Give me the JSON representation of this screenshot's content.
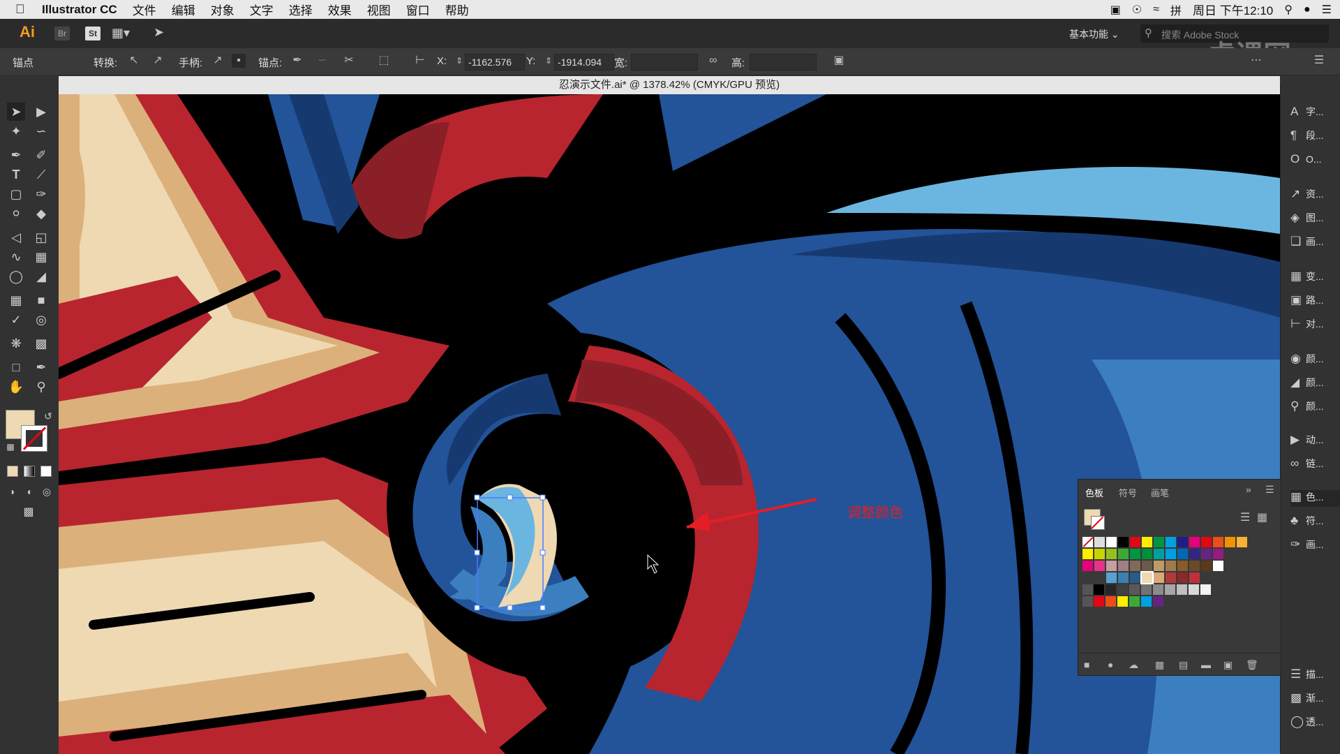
{
  "menubar": {
    "app_name": "Illustrator CC",
    "menus": [
      "文件",
      "编辑",
      "对象",
      "文字",
      "选择",
      "效果",
      "视图",
      "窗口",
      "帮助"
    ],
    "datetime": "周日 下午12:10"
  },
  "appbar": {
    "logo": "Ai",
    "bridge": "Br",
    "stock": "St",
    "workspace": "基本功能",
    "search_placeholder": "搜索 Adobe Stock",
    "watermark": "虎课网"
  },
  "control_bar": {
    "label_anchor": "锚点",
    "label_convert": "转换:",
    "label_handles": "手柄:",
    "label_anchors": "锚点:",
    "label_x": "X:",
    "x_value": "-1162.576",
    "label_y": "Y:",
    "y_value": "-1914.094",
    "label_width": "宽:",
    "label_height": "高:"
  },
  "document": {
    "title": "忍演示文件.ai* @ 1378.42% (CMYK/GPU 预览)"
  },
  "annotation": "调整颜色",
  "dock": {
    "items": [
      "字...",
      "段...",
      "O...",
      "资...",
      "图...",
      "画...",
      "变...",
      "路...",
      "对...",
      "颜...",
      "颜...",
      "颜...",
      "动...",
      "链...",
      "色...",
      "符...",
      "画...",
      "描...",
      "渐...",
      "透..."
    ]
  },
  "swatches_panel": {
    "tabs": [
      "色板",
      "符号",
      "画笔"
    ],
    "colors": {
      "row1": [
        "#ffffff",
        "#000000",
        "#e30613",
        "#ffed00",
        "#009640",
        "#00a0e3",
        "#1d1d8c",
        "#e6007e",
        "#e30613",
        "#e94e1b",
        "#f39200",
        "#f9b233"
      ],
      "row2": [
        "#ffed00",
        "#c8d400",
        "#95c11f",
        "#3aaa35",
        "#009640",
        "#008d36",
        "#00a19a",
        "#009fe3",
        "#0069b4",
        "#312783",
        "#662483",
        "#951b81"
      ],
      "row3": [
        "#e6007e",
        "#e6338a",
        "#c6a0a0",
        "#a08080",
        "#7f6a5a",
        "#6a5a4a",
        "#bf9a6a",
        "#a07a4a",
        "#8a5a2a",
        "#6a4a2a",
        "#5a3a1a",
        "#ffffff"
      ],
      "row4": [
        "#5aa0d0",
        "#3a80b0",
        "#2a5a8a",
        "#eed9b3",
        "#d9a979",
        "#b33a3a",
        "#8a2a2a",
        "#c0303a"
      ],
      "row5": [
        "#000000",
        "#262626",
        "#404040",
        "#595959",
        "#737373",
        "#8c8c8c",
        "#a6a6a6",
        "#bfbfbf",
        "#d9d9d9",
        "#f2f2f2"
      ],
      "row6": [
        "#e30613",
        "#e94e1b",
        "#ffed00",
        "#3aaa35",
        "#00a0e3",
        "#662483"
      ]
    }
  }
}
